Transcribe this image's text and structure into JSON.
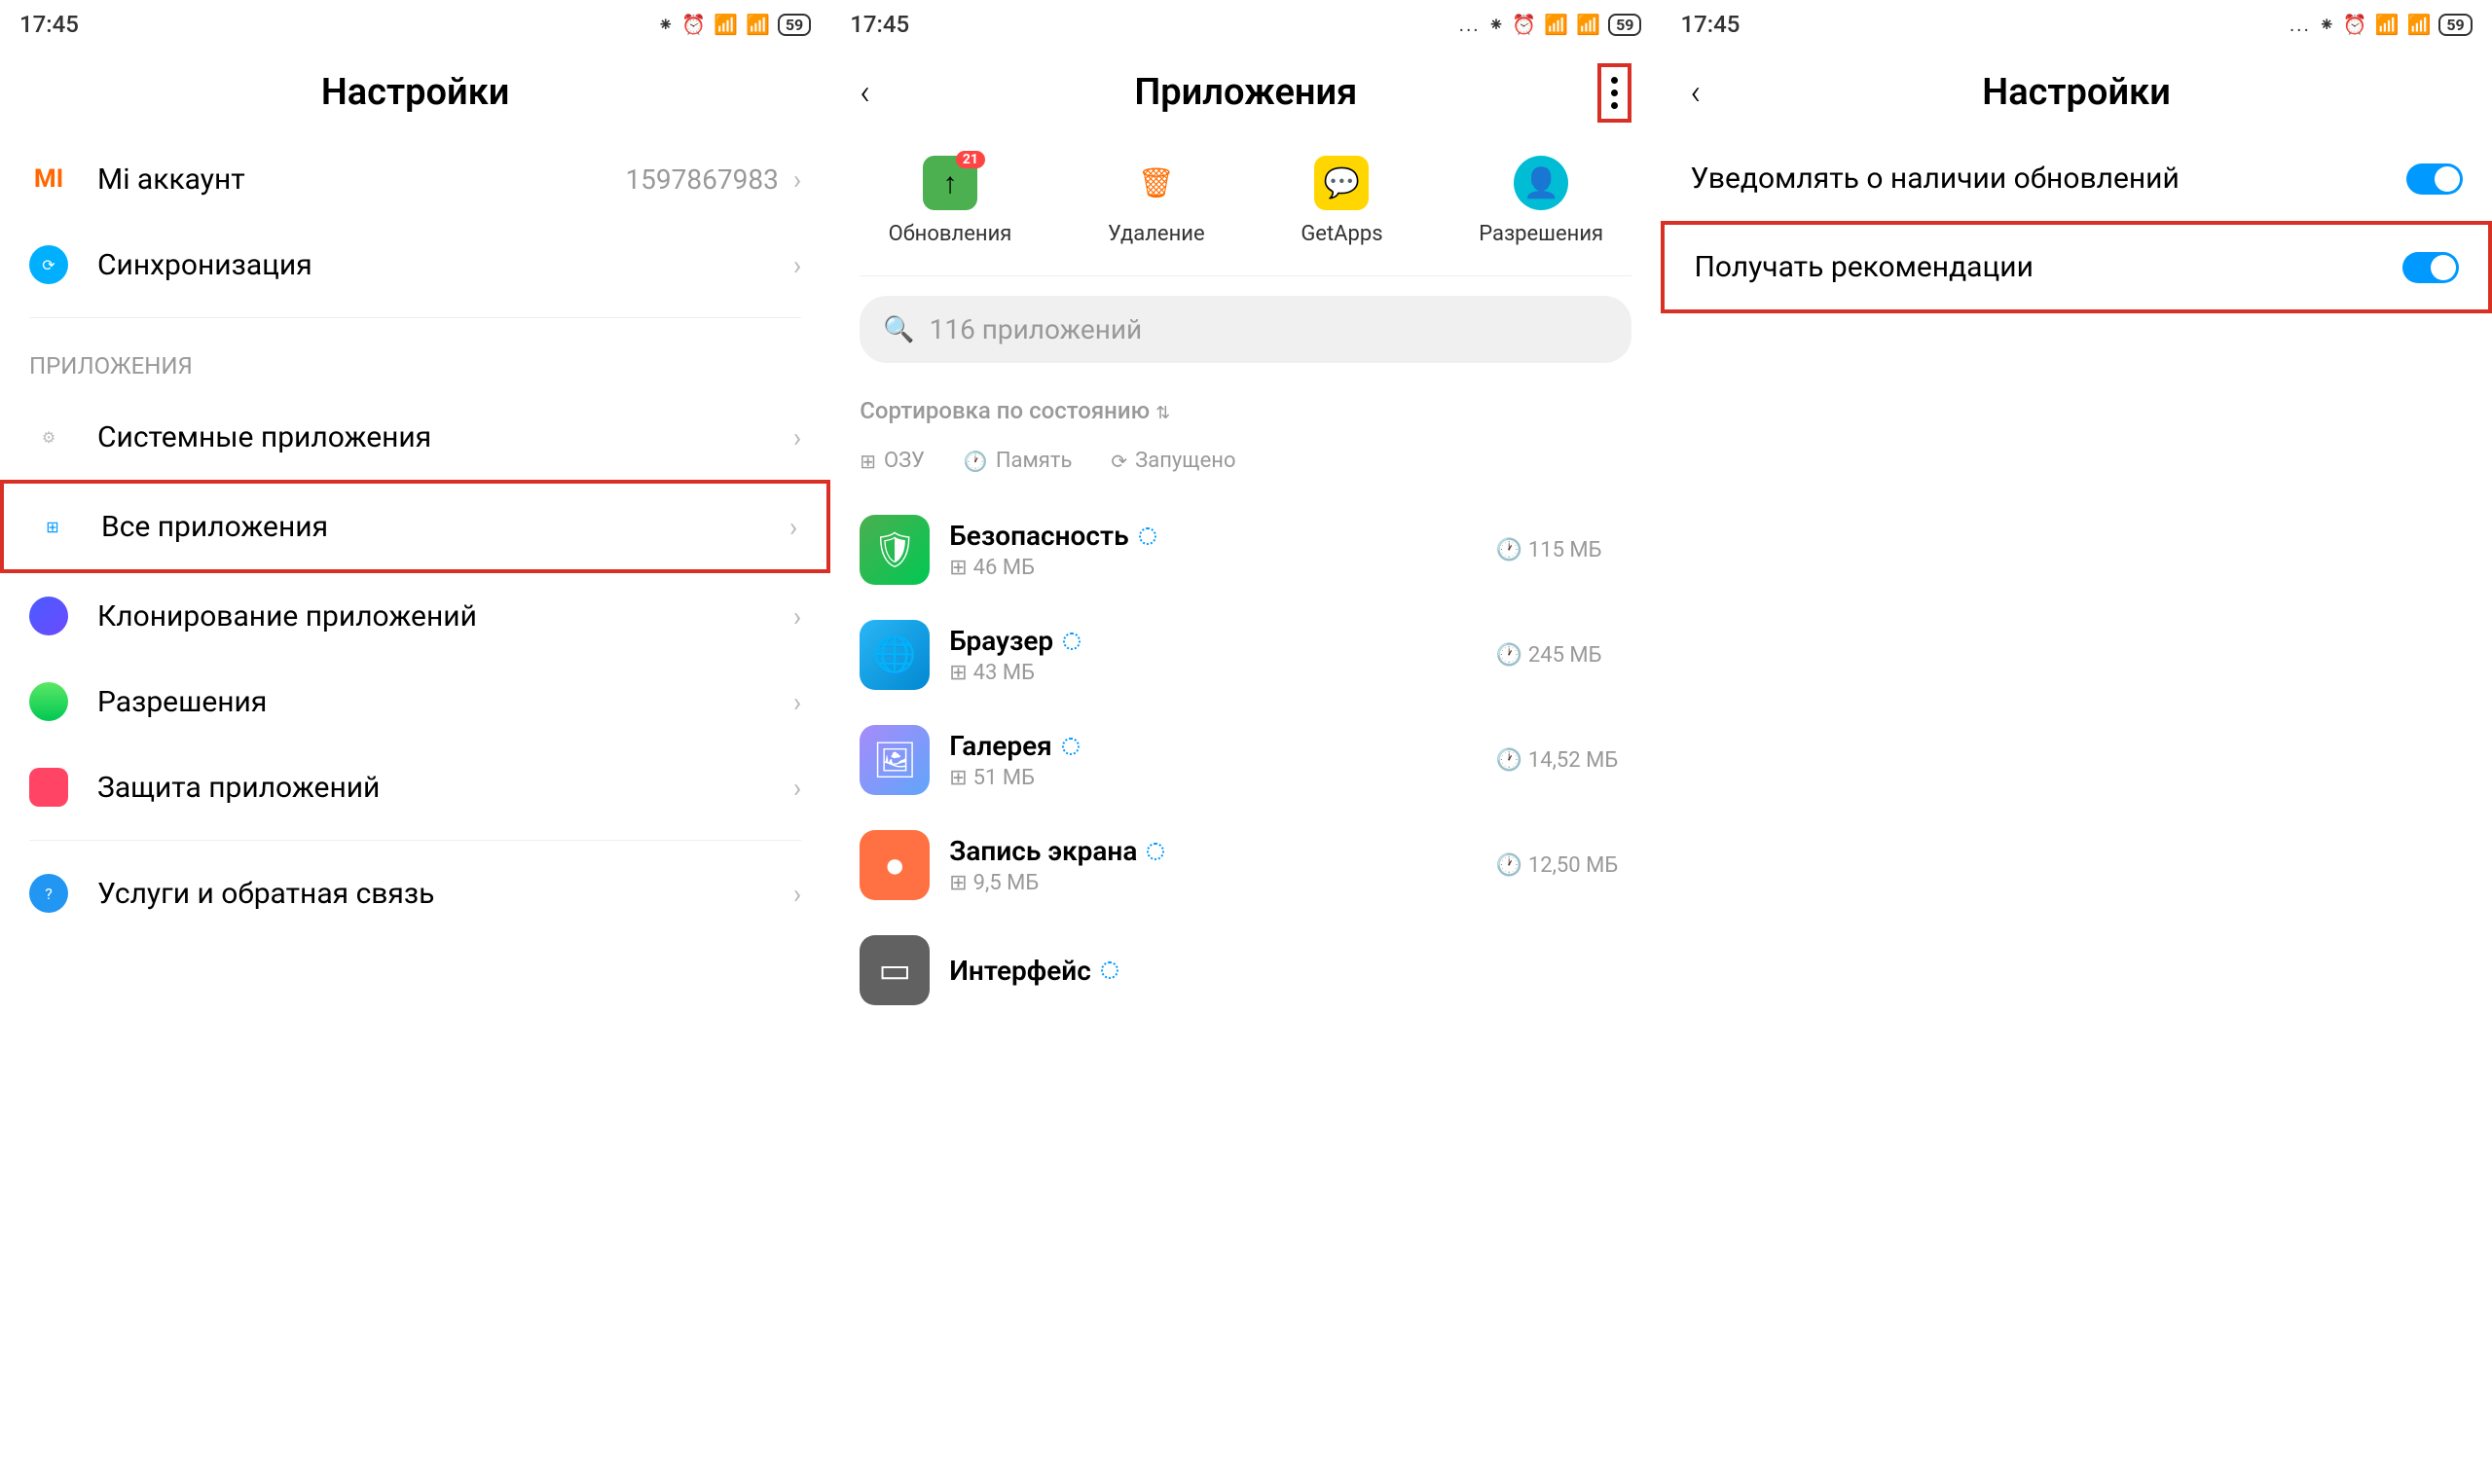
{
  "panel1": {
    "status": {
      "time": "17:45",
      "battery": "59"
    },
    "header": {
      "title": "Настройки"
    },
    "account": {
      "label": "Mi аккаунт",
      "value": "1597867983"
    },
    "sync": {
      "label": "Синхронизация"
    },
    "section_apps": "ПРИЛОЖЕНИЯ",
    "items": {
      "system": "Системные приложения",
      "all": "Все приложения",
      "clone": "Клонирование приложений",
      "perm": "Разрешения",
      "protect": "Защита приложений",
      "feedback": "Услуги и обратная связь"
    }
  },
  "panel2": {
    "status": {
      "time": "17:45",
      "battery": "59"
    },
    "header": {
      "title": "Приложения"
    },
    "actions": {
      "updates": "Обновления",
      "updates_count": "21",
      "delete": "Удаление",
      "getapps": "GetApps",
      "perms": "Разрешения"
    },
    "search": "116 приложений",
    "sort": "Сортировка по состоянию",
    "filters": {
      "ram": "ОЗУ",
      "storage": "Память",
      "running": "Запущено"
    },
    "apps": [
      {
        "name": "Безопасность",
        "ram": "46 МБ",
        "storage": "115 МБ",
        "bg": "ic-sec",
        "glyph": "🛡"
      },
      {
        "name": "Браузер",
        "ram": "43 МБ",
        "storage": "245 МБ",
        "bg": "ic-brw",
        "glyph": "🌐"
      },
      {
        "name": "Галерея",
        "ram": "51 МБ",
        "storage": "14,52 МБ",
        "bg": "ic-gal",
        "glyph": "🖼"
      },
      {
        "name": "Запись экрана",
        "ram": "9,5 МБ",
        "storage": "12,50 МБ",
        "bg": "ic-rec",
        "glyph": "●"
      },
      {
        "name": "Интерфейс",
        "ram": "",
        "storage": "",
        "bg": "ic-int",
        "glyph": "▭"
      }
    ]
  },
  "panel3": {
    "status": {
      "time": "17:45",
      "battery": "59"
    },
    "header": {
      "title": "Настройки"
    },
    "toggles": {
      "updates": "Уведомлять о наличии обновлений",
      "recommend": "Получать рекомендации"
    }
  }
}
